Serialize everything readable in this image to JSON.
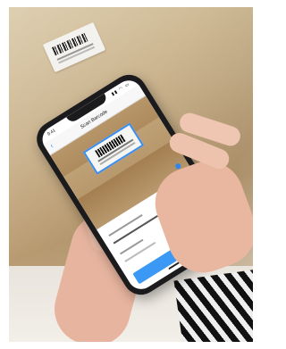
{
  "phone_app": {
    "status_time": "9:41",
    "status_icons": "▮▮ ◠ ▭",
    "nav_title": "Scan Barcode",
    "back_icon": "‹",
    "scan_button_label": "Scan"
  },
  "colors": {
    "accent": "#3b99f5",
    "cardboard": "#c8b08a"
  }
}
